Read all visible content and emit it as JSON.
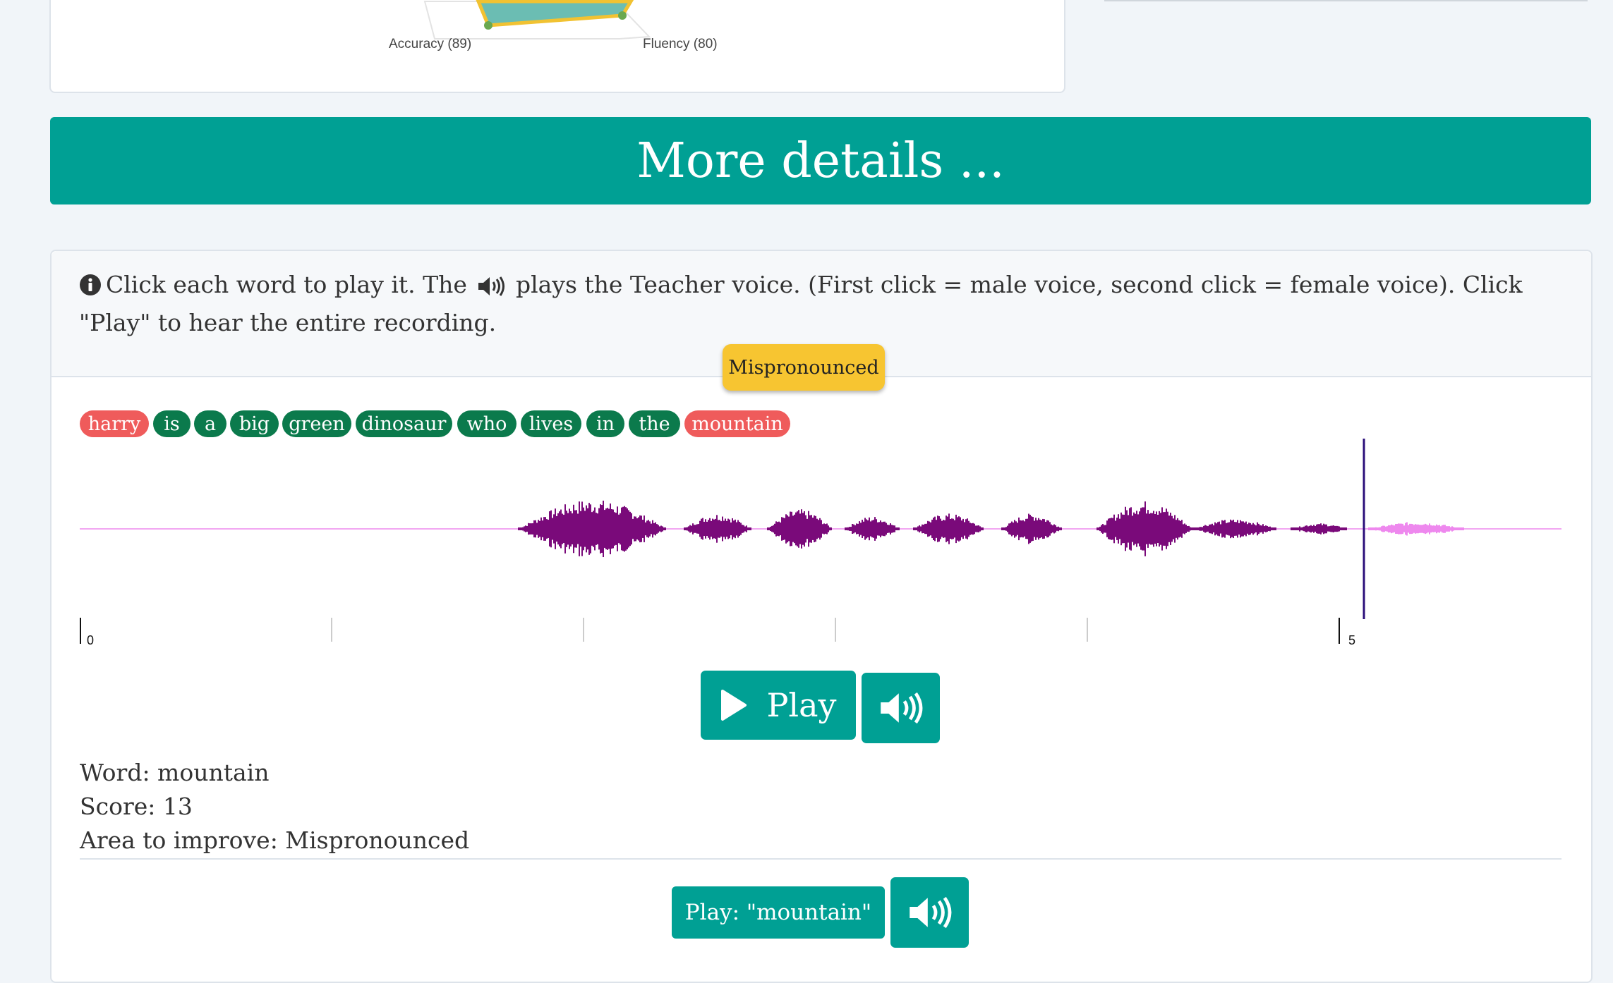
{
  "radar": {
    "axis_labels": [
      "Accuracy (89)",
      "Fluency (80)"
    ],
    "colors": {
      "fill": "#5fb5ac",
      "stroke": "#f1c232",
      "dot": "#6aa84f"
    }
  },
  "more_details_label": "More details ...",
  "instructions": {
    "part1": "Click each word to play it. The",
    "part2": "plays the Teacher voice. (First click = male voice, second click = female voice). Click \"Play\" to hear the entire recording."
  },
  "tooltip": "Mispronounced",
  "words": [
    {
      "text": "harry",
      "status": "bad"
    },
    {
      "text": "is",
      "status": "good"
    },
    {
      "text": "a",
      "status": "good"
    },
    {
      "text": "big",
      "status": "good"
    },
    {
      "text": "green",
      "status": "good"
    },
    {
      "text": "dinosaur",
      "status": "good"
    },
    {
      "text": "who",
      "status": "good"
    },
    {
      "text": "lives",
      "status": "good"
    },
    {
      "text": "in",
      "status": "good"
    },
    {
      "text": "the",
      "status": "good"
    },
    {
      "text": "mountain",
      "status": "bad"
    }
  ],
  "timeline": {
    "tick_labels": [
      "0",
      "5"
    ],
    "playhead_seconds": 5.1
  },
  "play_label": "Play",
  "word_detail": {
    "word": "Word: mountain",
    "score": "Score: 13",
    "area": "Area to improve: Mispronounced"
  },
  "play_word_label": "Play: \"mountain\"",
  "colors": {
    "accent": "#00a094",
    "good": "#0b7a4c",
    "bad": "#ef5b5b",
    "tooltip": "#f7c531",
    "wave_played": "#7a0a7a",
    "wave_unplayed": "#ee88ee"
  }
}
